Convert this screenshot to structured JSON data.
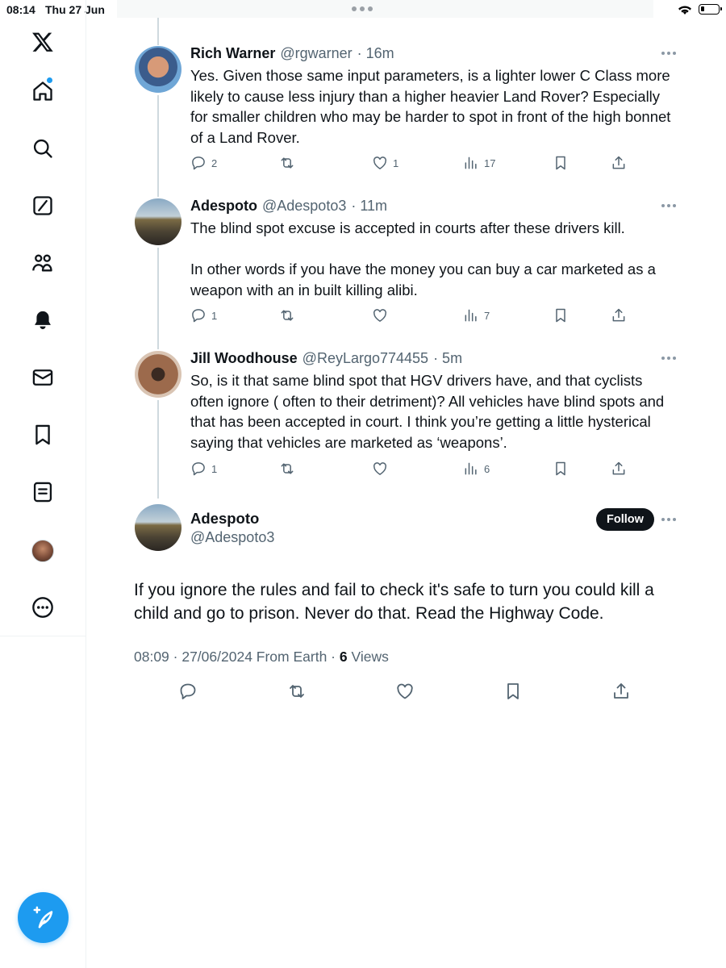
{
  "status_bar": {
    "time": "08:14",
    "date": "Thu 27 Jun"
  },
  "sidebar": {
    "items": [
      {
        "name": "x-logo",
        "icon": "x-logo-icon"
      },
      {
        "name": "home",
        "icon": "home-icon",
        "has_notification_dot": true
      },
      {
        "name": "search",
        "icon": "search-icon"
      },
      {
        "name": "grok",
        "icon": "grok-icon"
      },
      {
        "name": "communities",
        "icon": "communities-icon"
      },
      {
        "name": "notifications",
        "icon": "bell-icon"
      },
      {
        "name": "messages",
        "icon": "envelope-icon"
      },
      {
        "name": "bookmarks",
        "icon": "bookmark-icon"
      },
      {
        "name": "lists",
        "icon": "list-icon"
      },
      {
        "name": "profile",
        "icon": "avatar"
      },
      {
        "name": "more",
        "icon": "more-circle-icon"
      }
    ],
    "compose_icon": "compose-quill-icon"
  },
  "colors": {
    "accent": "#1d9bf0",
    "text": "#0f1419",
    "muted": "#536471",
    "follow_bg": "#0f1419"
  },
  "thread": [
    {
      "name": "Rich Warner",
      "handle": "@rgwarner",
      "time": "· 16m",
      "text": "Yes. Given those same input parameters, is a lighter lower C Class more likely to cause less injury than a higher heavier Land Rover? Especially for smaller children who may be harder to spot in front of the high bonnet of a Land Rover.",
      "replies": "2",
      "reposts": "",
      "likes": "1",
      "views": "17"
    },
    {
      "name": "Adespoto",
      "handle": "@Adespoto3",
      "time": "· 11m",
      "text": "The blind spot excuse is accepted in courts after these drivers kill.\n\nIn other words if you have the money you can buy a car marketed as a weapon with an in built killing alibi.",
      "replies": "1",
      "reposts": "",
      "likes": "",
      "views": "7"
    },
    {
      "name": "Jill Woodhouse",
      "handle": "@ReyLargo774455",
      "time": "· 5m",
      "text": "So, is it that same blind spot that HGV drivers have, and that cyclists often ignore ( often to their detriment)? All vehicles have blind spots and that has been accepted in court. I think you’re getting a little hysterical saying that vehicles are marketed as ‘weapons’.",
      "replies": "1",
      "reposts": "",
      "likes": "",
      "views": "6"
    }
  ],
  "main_tweet": {
    "name": "Adespoto",
    "handle": "@Adespoto3",
    "follow_label": "Follow",
    "text": "If you ignore the rules and fail to check it's safe to turn you could kill a child and go to prison. Never do that. Read the Highway Code.",
    "timestamp": "08:09 · 27/06/2024 From Earth ·",
    "views_count": "6",
    "views_label": "Views"
  }
}
